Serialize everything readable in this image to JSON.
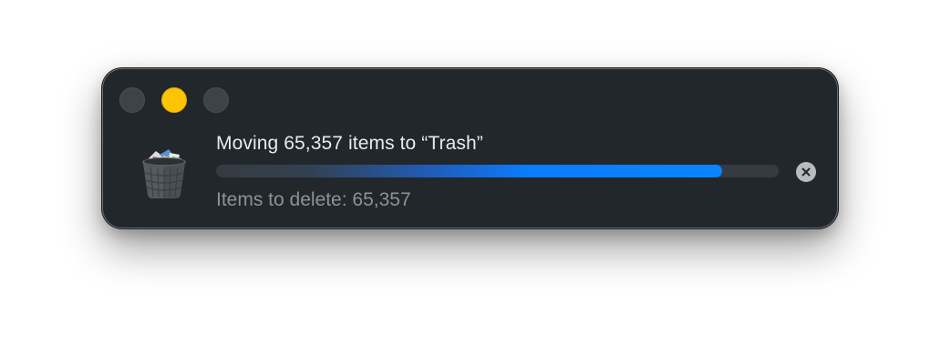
{
  "window": {
    "title_text": "Moving 65,357 items to “Trash”",
    "subtitle_text": "Items to delete: 65,357",
    "progress_fraction": 0.9
  },
  "icons": {
    "trash": "trash-can-icon",
    "cancel": "cancel-x-icon"
  },
  "colors": {
    "window_bg": "#22272c",
    "accent": "#0a84ff",
    "minimize_light": "#fdc501",
    "inactive_light": "#3e4348"
  }
}
